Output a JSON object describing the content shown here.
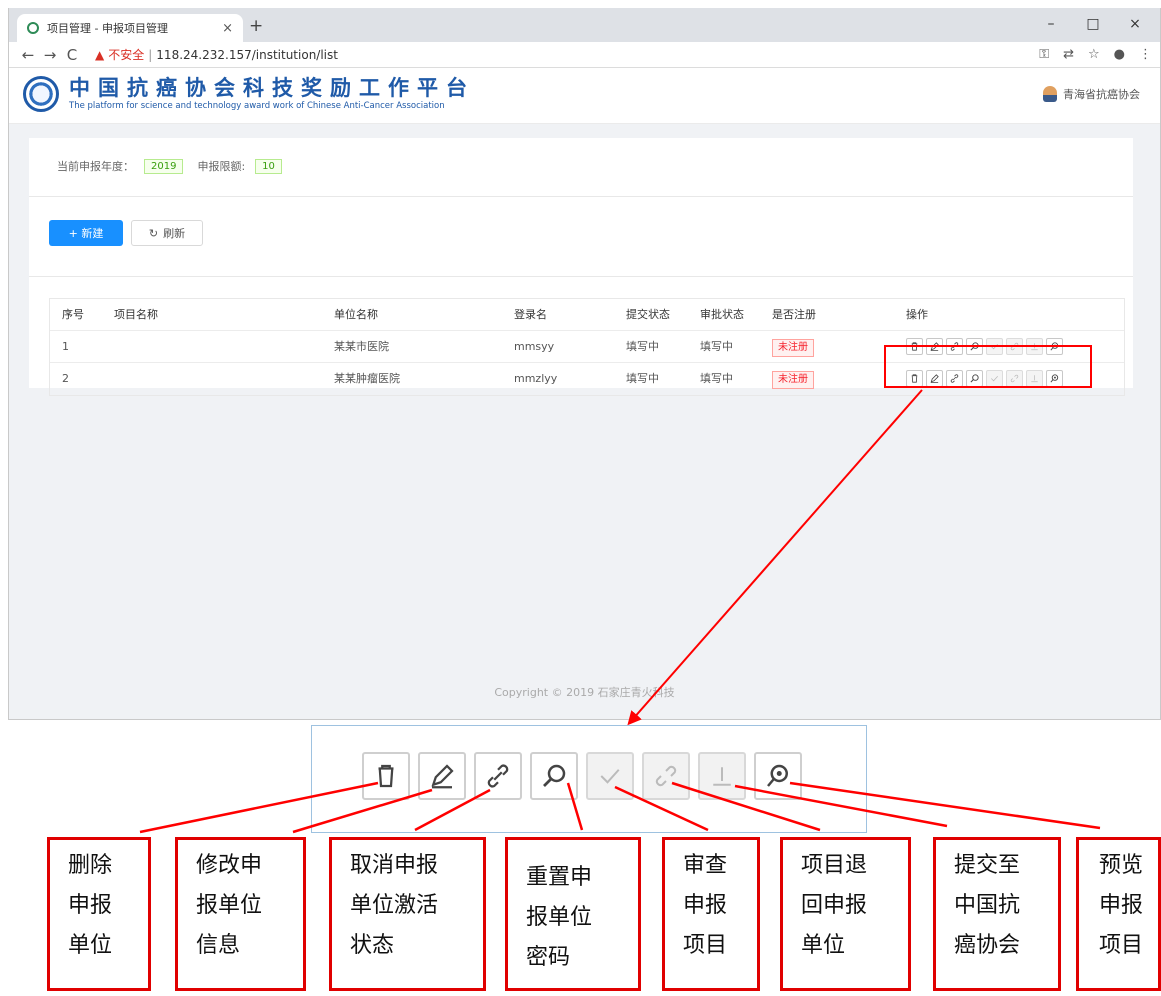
{
  "browser": {
    "tab_title": "项目管理 - 申报项目管理",
    "tab_close": "×",
    "new_tab": "+",
    "window_controls": [
      "–",
      "□",
      "×"
    ],
    "nav": {
      "back": "←",
      "forward": "→",
      "reload": "C"
    },
    "insecure_label": "不安全",
    "url_separator": "|",
    "url": "118.24.232.157/institution/list",
    "toolbar_icons": [
      "key-icon",
      "translate-icon",
      "star-icon",
      "account-icon",
      "menu-icon"
    ]
  },
  "header": {
    "title": "中国抗癌协会科技奖励工作平台",
    "subtitle": "The platform for science and technology award work of Chinese Anti-Cancer Association",
    "user": "青海省抗癌协会"
  },
  "filters": {
    "year_label": "当前申报年度：",
    "year_value": "2019",
    "limit_label": "申报限额:",
    "limit_value": "10"
  },
  "actions": {
    "new_label": "+ 新建",
    "refresh_icon": "↻",
    "refresh_label": "刷新"
  },
  "table": {
    "columns": [
      "序号",
      "项目名称",
      "单位名称",
      "登录名",
      "提交状态",
      "审批状态",
      "是否注册",
      "操作"
    ],
    "rows": [
      {
        "index": "1",
        "project": "",
        "unit": "某某市医院",
        "login": "mmsyy",
        "submit": "填写中",
        "approval": "填写中",
        "registered": "未注册"
      },
      {
        "index": "2",
        "project": "",
        "unit": "某某肿瘤医院",
        "login": "mmzlyy",
        "submit": "填写中",
        "approval": "填写中",
        "registered": "未注册"
      }
    ],
    "op_icons": [
      "trash-icon",
      "edit-icon",
      "cancel-activation-icon",
      "search-icon",
      "check-icon",
      "unlink-icon",
      "submit-icon",
      "preview-icon"
    ],
    "op_disabled": [
      false,
      false,
      false,
      false,
      true,
      true,
      true,
      false
    ]
  },
  "footer": {
    "copyright": "Copyright © 2019 石家庄青火科技"
  },
  "annotations": {
    "labels": [
      "删除\n申报\n单位",
      "修改申\n报单位\n信息",
      "取消申报\n单位激活\n状态",
      "重置申\n报单位\n密码",
      "审查\n申报\n项目",
      "项目退\n回申报\n单位",
      "提交至\n中国抗\n癌协会",
      "预览\n申报\n项目"
    ],
    "line_color": "#ff0000"
  }
}
